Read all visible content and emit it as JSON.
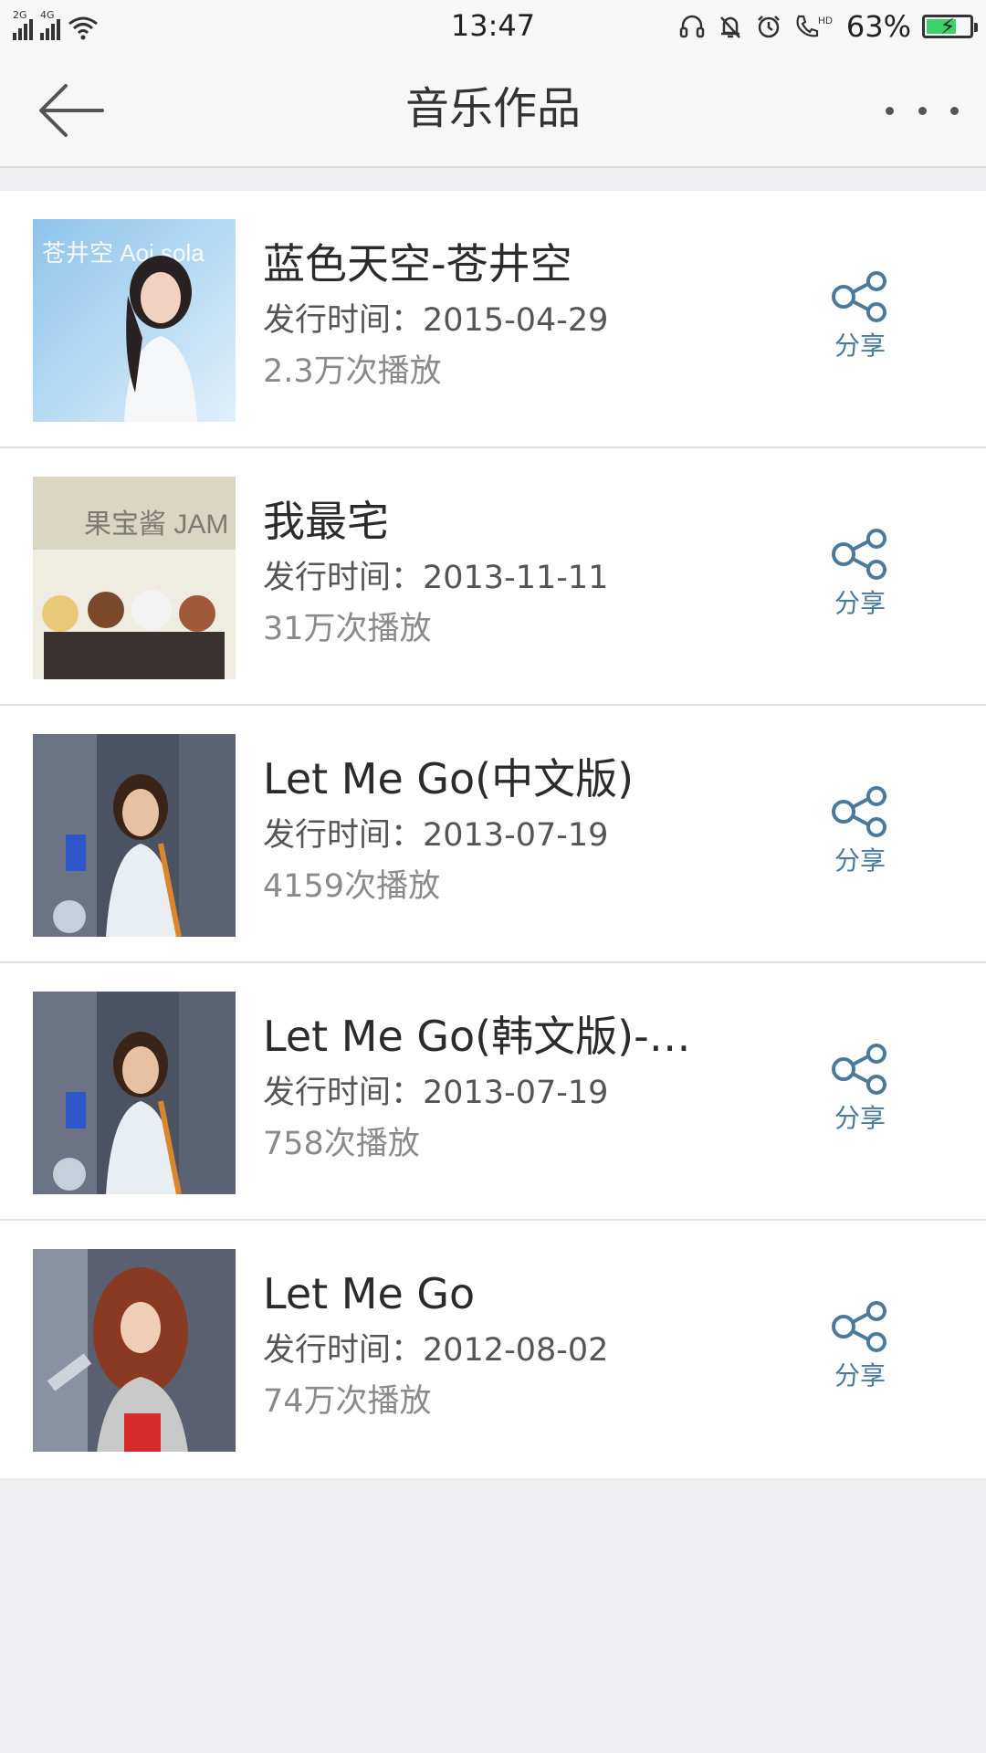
{
  "status_bar": {
    "network_1": "2G",
    "network_2": "4G",
    "time": "13:47",
    "hd_label": "HD",
    "battery_percent": "63%",
    "battery_level": 0.63,
    "icons": [
      "headset-icon",
      "bell-off-icon",
      "alarm-icon",
      "hd-call-icon",
      "battery-icon",
      "wifi-icon"
    ]
  },
  "nav": {
    "title": "音乐作品",
    "back_icon": "arrow-left-icon",
    "more_icon": "more-dots-icon"
  },
  "songs": [
    {
      "title": "蓝色天空-苍井空",
      "release": "发行时间：2015-04-29",
      "plays": "2.3万次播放",
      "share_label": "分享",
      "cover_text": "苍井空 Aoi sola"
    },
    {
      "title": "我最宅",
      "release": "发行时间：2013-11-11",
      "plays": "31万次播放",
      "share_label": "分享",
      "cover_text": "果宝酱 JAM"
    },
    {
      "title": "Let Me Go(中文版)",
      "release": "发行时间：2013-07-19",
      "plays": "4159次播放",
      "share_label": "分享"
    },
    {
      "title": "Let Me Go(韩文版)-苍...",
      "release": "发行时间：2013-07-19",
      "plays": "758次播放",
      "share_label": "分享"
    },
    {
      "title": "Let Me Go",
      "release": "发行时间：2012-08-02",
      "plays": "74万次播放",
      "share_label": "分享"
    }
  ],
  "colors": {
    "share_blue": "#4a7a9c",
    "battery_green": "#3ccf6e",
    "background": "#efeff1"
  }
}
